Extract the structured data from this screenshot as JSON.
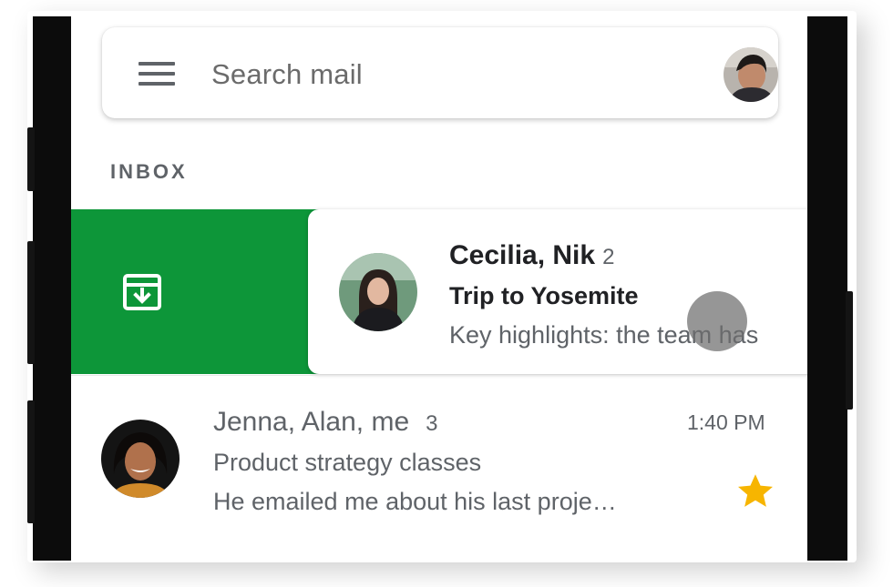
{
  "search": {
    "placeholder": "Search mail",
    "menu_icon": "menu-icon",
    "avatar_icon": "account-avatar"
  },
  "section_label": "INBOX",
  "swipe_action": {
    "icon": "archive-icon",
    "background_color": "#0d9639"
  },
  "emails": [
    {
      "senders": "Cecilia, Nik",
      "count": "2",
      "subject": "Trip to Yosemite",
      "snippet": "Key highlights: the team has",
      "unread": true
    },
    {
      "senders": "Jenna, Alan, me",
      "count": "3",
      "subject": "Product strategy classes",
      "snippet": "He emailed me about his last proje…",
      "time": "1:40 PM",
      "unread": false,
      "starred": true,
      "star_color": "#f7b500"
    }
  ]
}
